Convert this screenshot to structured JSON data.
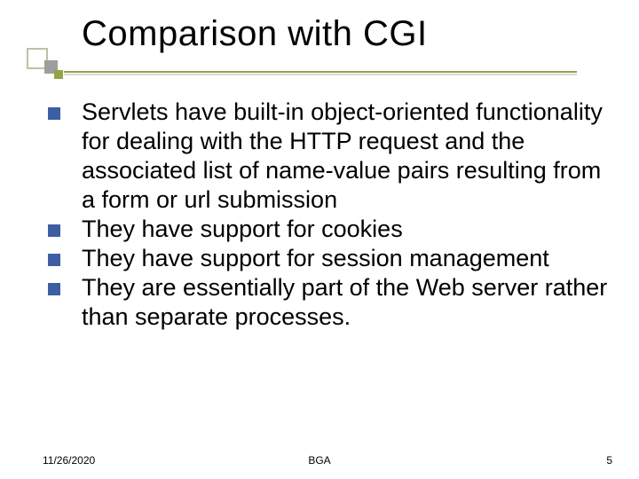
{
  "title": "Comparison with CGI",
  "bullets": [
    "Servlets have built-in object-oriented functionality for dealing with the HTTP request and the associated list of name-value pairs resulting from a form or url submission",
    "They have support for cookies",
    "They have support for session management",
    "They are essentially part of the Web server rather than separate processes."
  ],
  "footer": {
    "date": "11/26/2020",
    "center": "BGA",
    "page": "5"
  }
}
